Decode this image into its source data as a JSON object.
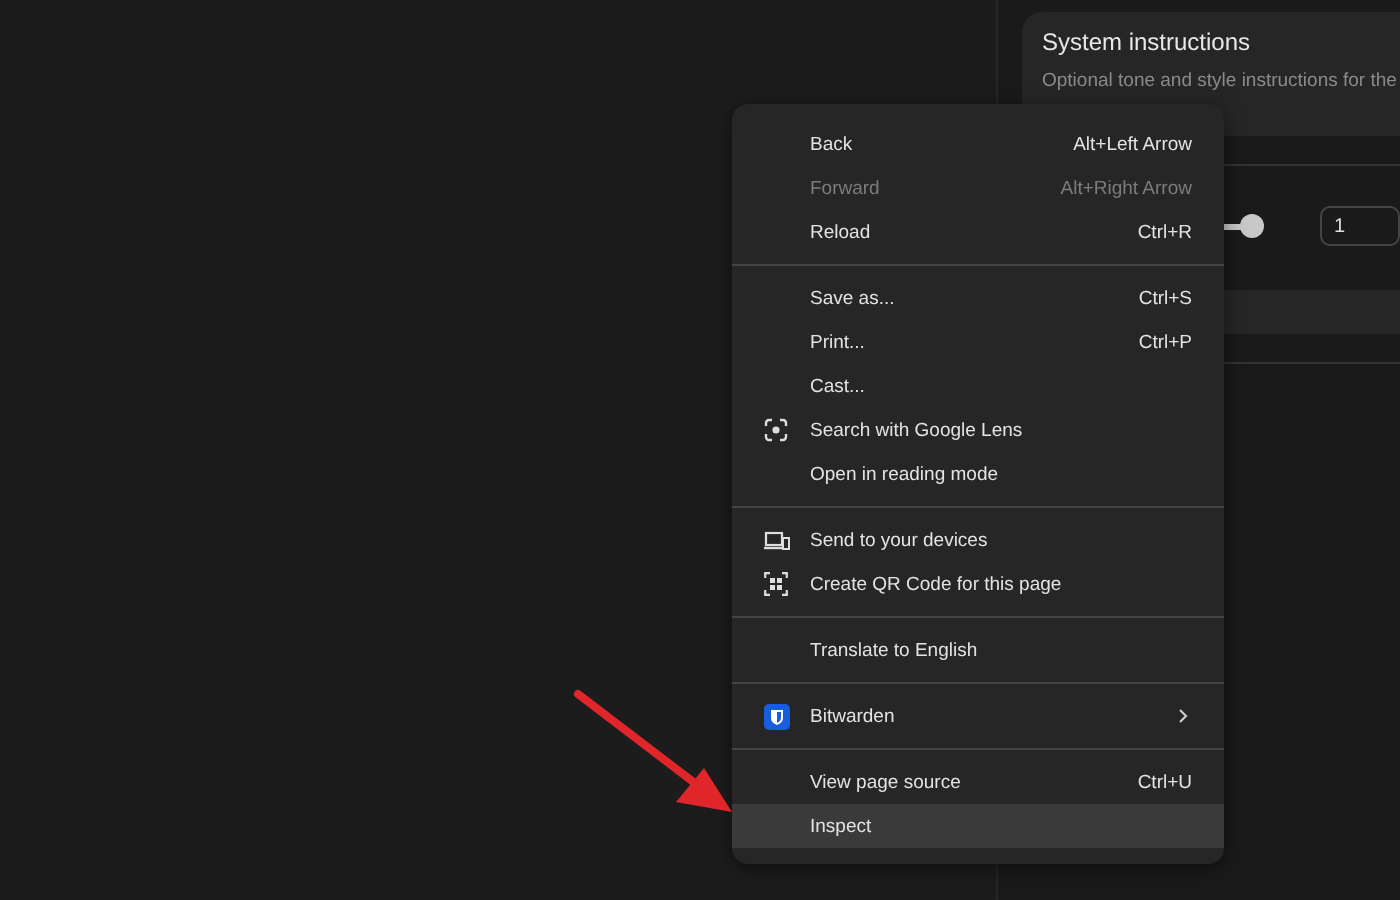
{
  "panel": {
    "card": {
      "title": "System instructions",
      "description": "Optional tone and style instructions for the"
    },
    "slider": {
      "level": 1
    },
    "number_field": {
      "value": "1"
    }
  },
  "context_menu": {
    "groups": [
      {
        "items": [
          {
            "label": "Back",
            "shortcut": "Alt+Left Arrow",
            "disabled": false,
            "selected": false,
            "kind": "plain"
          },
          {
            "label": "Forward",
            "shortcut": "Alt+Right Arrow",
            "disabled": true,
            "selected": false,
            "kind": "plain"
          },
          {
            "label": "Reload",
            "shortcut": "Ctrl+R",
            "disabled": false,
            "selected": false,
            "kind": "plain"
          }
        ]
      },
      {
        "items": [
          {
            "label": "Save as...",
            "shortcut": "Ctrl+S",
            "disabled": false,
            "selected": false,
            "kind": "plain"
          },
          {
            "label": "Print...",
            "shortcut": "Ctrl+P",
            "disabled": false,
            "selected": false,
            "kind": "plain"
          },
          {
            "label": "Cast...",
            "disabled": false,
            "selected": false,
            "kind": "plain"
          },
          {
            "label": "Search with Google Lens",
            "disabled": false,
            "selected": false,
            "kind": "lens"
          },
          {
            "label": "Open in reading mode",
            "disabled": false,
            "selected": false,
            "kind": "plain"
          }
        ]
      },
      {
        "items": [
          {
            "label": "Send to your devices",
            "disabled": false,
            "selected": false,
            "kind": "devices"
          },
          {
            "label": "Create QR Code for this page",
            "disabled": false,
            "selected": false,
            "kind": "qr"
          }
        ]
      },
      {
        "items": [
          {
            "label": "Translate to English",
            "disabled": false,
            "selected": false,
            "kind": "plain"
          }
        ]
      },
      {
        "items": [
          {
            "label": "Bitwarden",
            "disabled": false,
            "selected": false,
            "kind": "shield",
            "submenu": true
          }
        ]
      },
      {
        "items": [
          {
            "label": "View page source",
            "shortcut": "Ctrl+U",
            "disabled": false,
            "selected": false,
            "kind": "plain"
          },
          {
            "label": "Inspect",
            "disabled": false,
            "selected": true,
            "kind": "plain"
          }
        ]
      }
    ]
  }
}
